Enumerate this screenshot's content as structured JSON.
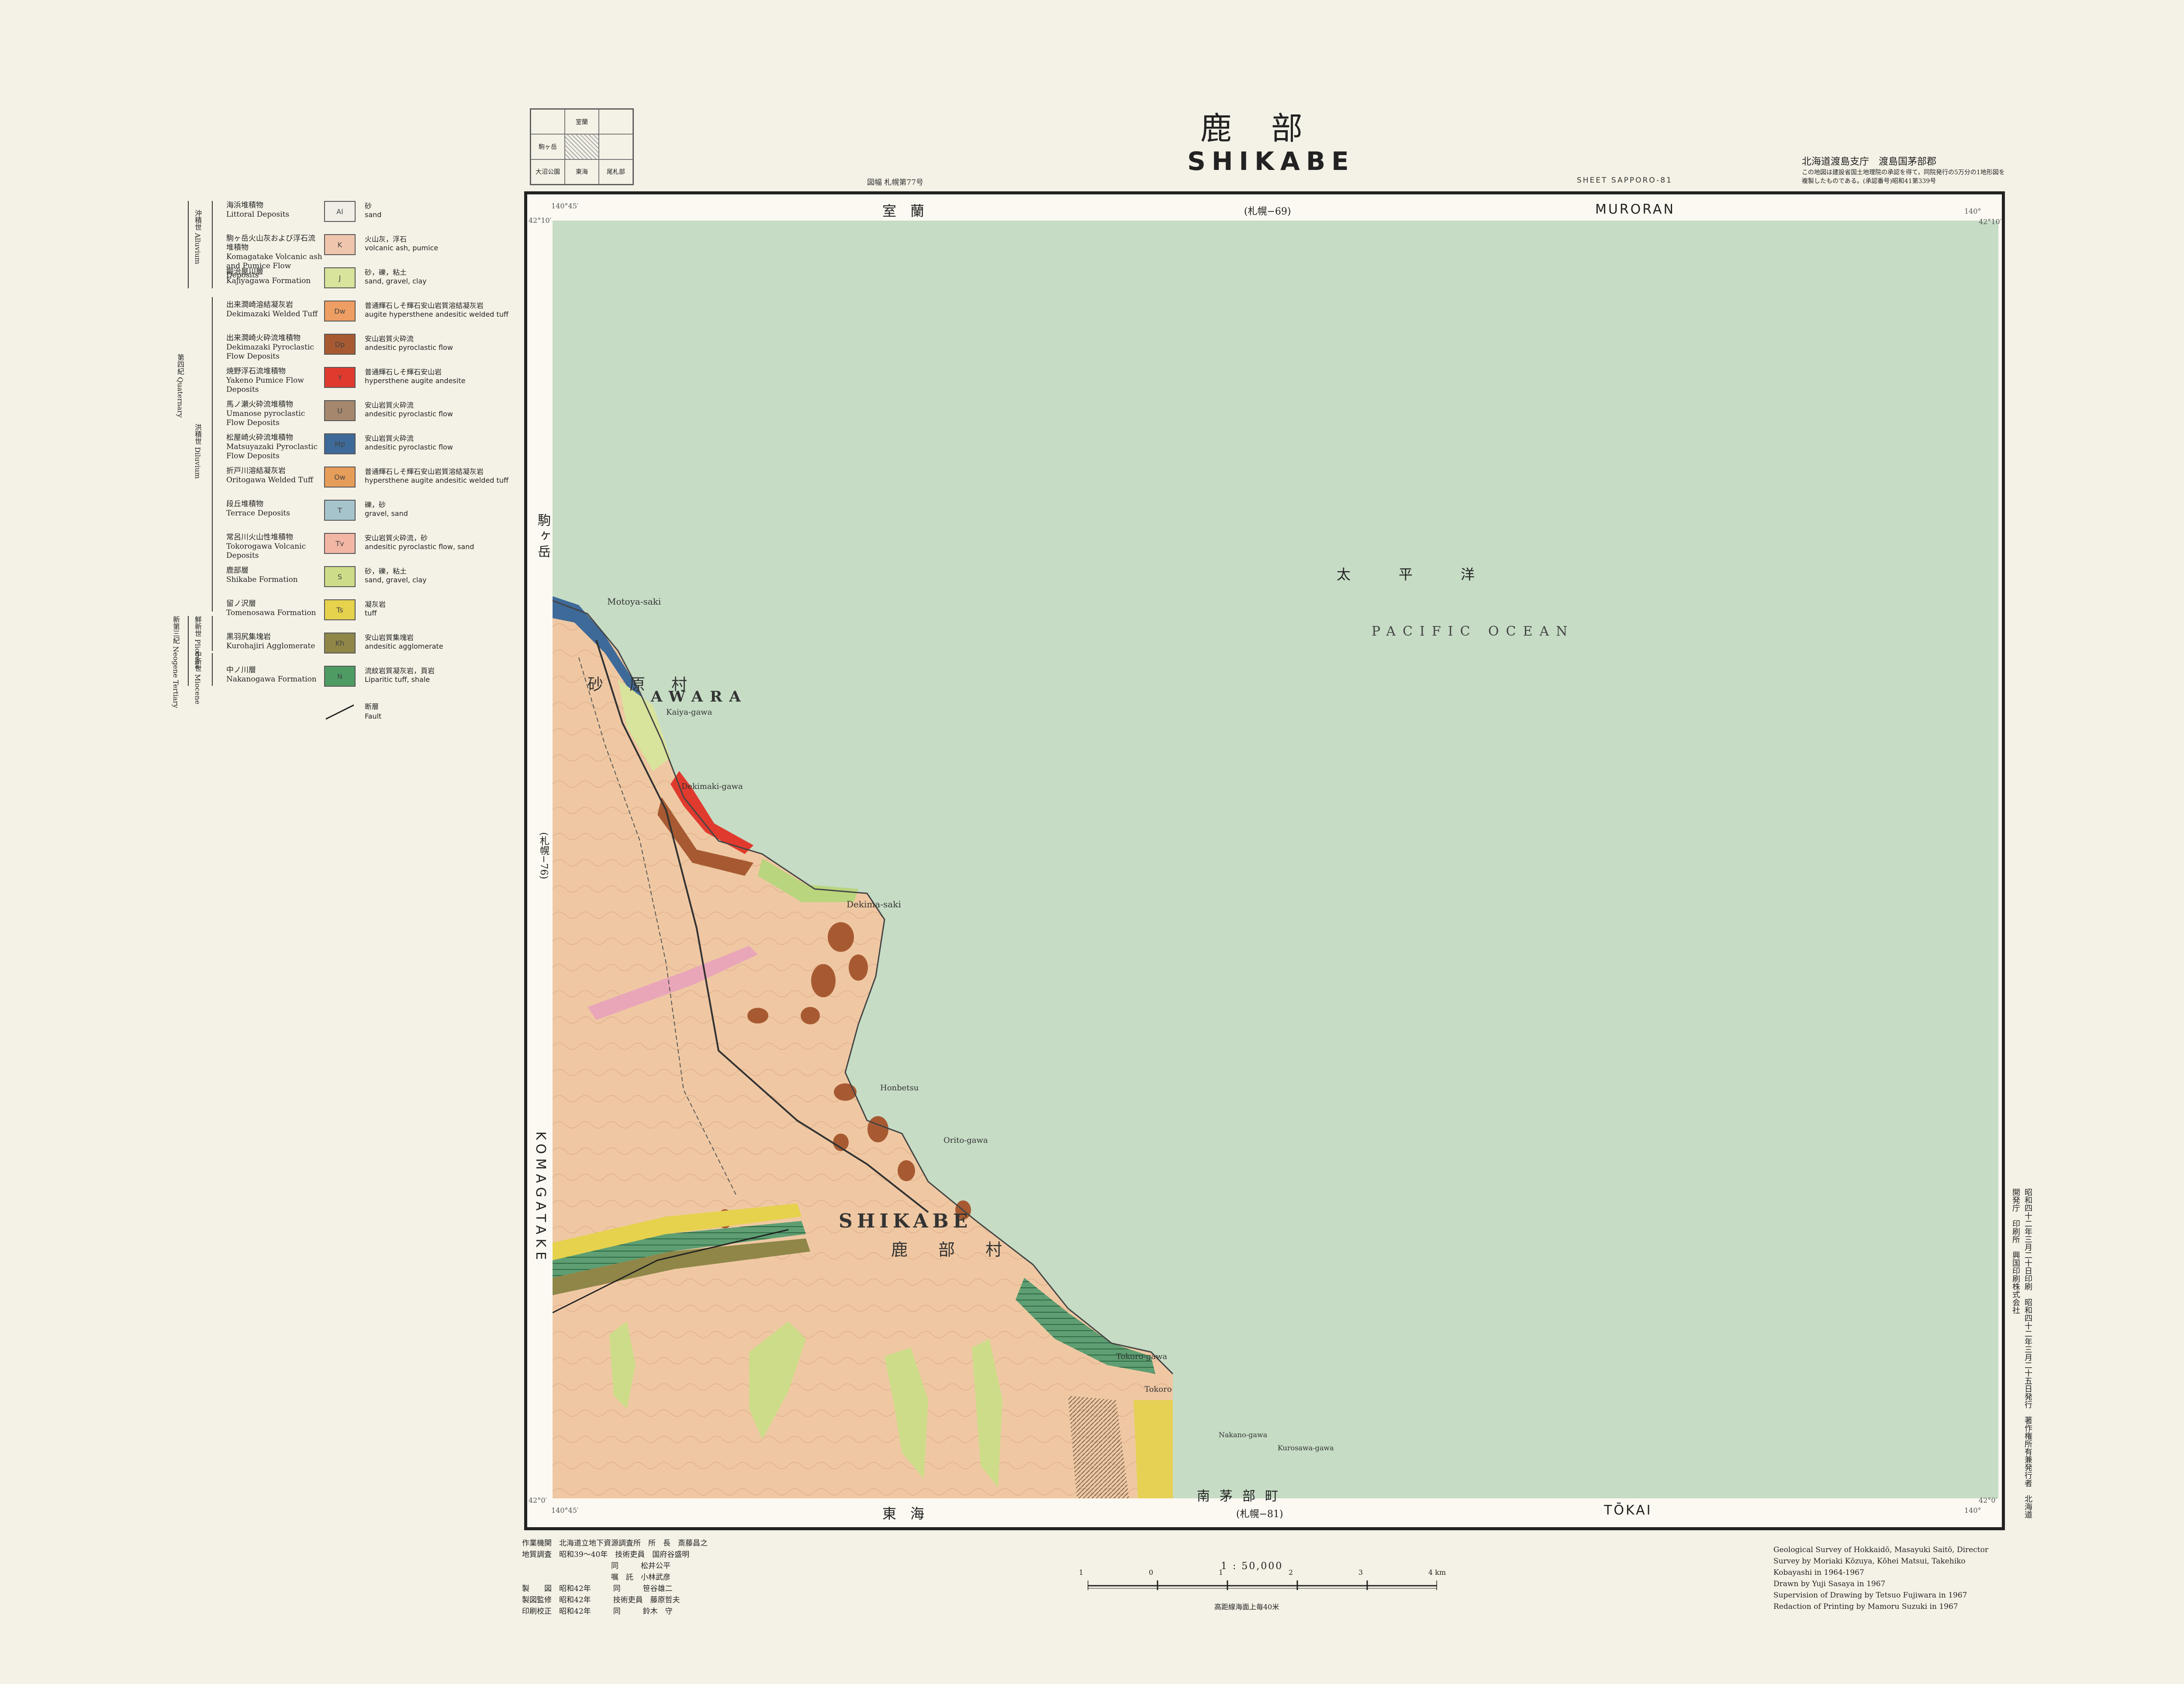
{
  "title": {
    "jp": "鹿部",
    "en": "SHIKABE"
  },
  "index_grid": [
    "",
    "室蘭",
    "",
    "駒ヶ岳",
    "",
    "",
    "大沼公園",
    "東海",
    "尾札部"
  ],
  "sheet_no_left": "図幅 札幌第77号",
  "sheet_no_right": "SHEET SAPPORO-81",
  "publisher": {
    "jp": "北海道渡島支庁　渡島国茅部郡",
    "note": "この地図は建設省国土地理院の承認を得て，同院発行の5万分の1地形図を複製したものである。(承認番号)昭和41第339号"
  },
  "borders": {
    "top_jp": "室　蘭",
    "top_code": "(札幌−69)",
    "top_en": "MURORAN",
    "bottom_jp": "東　海",
    "bottom_code": "(札幌−81)",
    "bottom_en": "TŌKAI",
    "bottom_village": "南茅部町",
    "left_jp": "駒ヶ岳",
    "left_code": "(札幌−76)",
    "left_en": "KOMAGATAKE"
  },
  "corner_coords": {
    "tl_lon": "140°45′",
    "tl_lat": "42°10′",
    "tr_lon": "140°",
    "tr_lat": "42°10′",
    "bl_lat": "42°0′",
    "bl_lon": "140°45′",
    "br_lat": "42°0′",
    "br_lon": "140°"
  },
  "sea": {
    "jp": "太平洋",
    "en": "PACIFIC OCEAN"
  },
  "places": {
    "shikabe_en": "SHIKABE",
    "shikabe_mura": "鹿部村",
    "usuhara_mura": "砂原村",
    "awara": "AWARA",
    "motoya_saki": "Motoya-saki",
    "kaiya_gawa": "Kaiya-gawa",
    "dekimaki_gawa": "Dekimaki-gawa",
    "dekima_saki": "Dekima-saki",
    "orito_gawa": "Orito-gawa",
    "tokoro_gawa": "Tokoro-gawa",
    "honbetsu": "Honbetsu",
    "tokoro": "Tokoro",
    "nakano_gawa": "Nakano-gawa",
    "kurosawa_gawa": "Kurosawa-gawa"
  },
  "legend": [
    {
      "jp": "海浜堆積物",
      "en": "Littoral Deposits",
      "code": "Al",
      "desc_jp": "砂",
      "desc_en": "sand",
      "color": "#f1eee8"
    },
    {
      "jp": "駒ヶ岳火山灰および浮石流堆積物",
      "en": "Komagatake Volcanic ash and Pumice Flow Deposits",
      "code": "K",
      "desc_jp": "火山灰，浮石",
      "desc_en": "volcanic ash, pumice",
      "color": "#efc5ad"
    },
    {
      "jp": "鍛治屋川層",
      "en": "Kajiyagawa Formation",
      "code": "J",
      "desc_jp": "砂，礫，粘土",
      "desc_en": "sand, gravel, clay",
      "color": "#d8e39c"
    },
    {
      "jp": "出来澗崎溶結凝灰岩",
      "en": "Dekimazaki Welded Tuff",
      "code": "Dw",
      "desc_jp": "普通輝石しそ輝石安山岩質溶結凝灰岩",
      "desc_en": "augite hypersthene andesitic welded tuff",
      "color": "#ef9e63"
    },
    {
      "jp": "出来澗崎火砕流堆積物",
      "en": "Dekimazaki Pyroclastic Flow Deposits",
      "code": "Dp",
      "desc_jp": "安山岩質火砕流",
      "desc_en": "andesitic pyroclastic flow",
      "color": "#a75a32"
    },
    {
      "jp": "焼野浮石流堆積物",
      "en": "Yakeno Pumice Flow Deposits",
      "code": "Y",
      "desc_jp": "普通輝石しそ輝石安山岩",
      "desc_en": "hypersthene augite andesite",
      "color": "#e03a2e"
    },
    {
      "jp": "馬ノ瀬火砕流堆積物",
      "en": "Umanose pyroclastic Flow Deposits",
      "code": "U",
      "desc_jp": "安山岩質火砕流",
      "desc_en": "andesitic pyroclastic flow",
      "color": "#a4876d"
    },
    {
      "jp": "松屋崎火砕流堆積物",
      "en": "Matsuyazaki Pyroclastic Flow Deposits",
      "code": "Mp",
      "desc_jp": "安山岩質火砕流",
      "desc_en": "andesitic pyroclastic flow",
      "color": "#3e6a99"
    },
    {
      "jp": "折戸川溶結凝灰岩",
      "en": "Oritogawa Welded Tuff",
      "code": "Ow",
      "desc_jp": "普通輝石しそ輝石安山岩質溶結凝灰岩",
      "desc_en": "hypersthene augite andesitic welded tuff",
      "color": "#e79d5a"
    },
    {
      "jp": "段丘堆積物",
      "en": "Terrace Deposits",
      "code": "T",
      "desc_jp": "礫，砂",
      "desc_en": "gravel, sand",
      "color": "#a6c4cc"
    },
    {
      "jp": "常呂川火山性堆積物",
      "en": "Tokorogawa Volcanic Deposits",
      "code": "Tv",
      "desc_jp": "安山岩質火砕流，砂",
      "desc_en": "andesitic pyroclastic flow, sand",
      "color": "#f2b6a5"
    },
    {
      "jp": "鹿部層",
      "en": "Shikabe Formation",
      "code": "S",
      "desc_jp": "砂，礫，粘土",
      "desc_en": "sand, gravel, clay",
      "color": "#cddc88"
    },
    {
      "jp": "留ノ沢層",
      "en": "Tomenosawa Formation",
      "code": "Ts",
      "desc_jp": "凝灰岩",
      "desc_en": "tuff",
      "color": "#e6d24c"
    },
    {
      "jp": "黒羽尻集塊岩",
      "en": "Kurohajiri Agglomerate",
      "code": "Kh",
      "desc_jp": "安山岩質集塊岩",
      "desc_en": "andesitic agglomerate",
      "color": "#8f8648"
    },
    {
      "jp": "中ノ川層",
      "en": "Nakanogawa Formation",
      "code": "N",
      "desc_jp": "流紋岩質凝灰岩，頁岩",
      "desc_en": "Liparitic tuff, shale",
      "color": "#4e9b63"
    }
  ],
  "legend_fault": {
    "jp": "断層",
    "en": "Fault"
  },
  "legend_eras": {
    "alluvium": "沖積世 Alluvium",
    "quaternary": "第四紀 Quaternary",
    "diluvium": "洪積世 Diluvium",
    "pliocene": "鮮新世 Pliocene",
    "miocene": "中新世 Miocene",
    "neogene": "新第三紀 Neogene Tertiary"
  },
  "credits_jp": "作業機関　北海道立地下資源調査所　所　長　斎藤昌之\n地質調査　昭和39～40年　技術吏員　国府谷盛明\n　　　　　　　　　　　　同　　　松井公平\n　　　　　　　　　　　　嘱　託　小林武彦\n製　　図　昭和42年　　　同　　　笹谷雄二\n製図監修　昭和42年　　　技術吏員　藤原哲夫\n印刷校正　昭和42年　　　同　　　鈴木　守",
  "credits_en": [
    "Geological Survey of Hokkaidō, Masayuki Saitō, Director",
    "Survey by Moriaki Kōzuya, Kōhei Matsui, Takehiko",
    "Kobayashi in 1964-1967",
    "Drawn by Yuji Sasaya in 1967",
    "Supervision of Drawing by Tetsuo Fujiwara in 1967",
    "Redaction of Printing by Mamoru Suzuki in 1967"
  ],
  "scale": {
    "text": "1 : 50,000",
    "ticks": [
      "1",
      "0",
      "1",
      "2",
      "3",
      "4 km"
    ],
    "note": "高距線海面上毎40米"
  },
  "right_margin": "昭和四十二年三月二十日印刷　昭和四十二年三月二十五日発行　著作権所有兼発行者　北海道開発庁　印刷所　興国印刷株式会社",
  "colors": {
    "sea": "#c6dcc5",
    "land": "#efc8a3",
    "frame": "#222222"
  }
}
